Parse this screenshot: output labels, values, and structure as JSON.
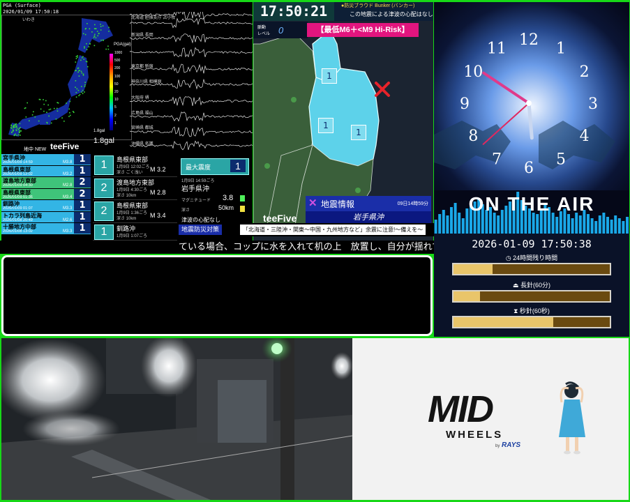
{
  "seismic": {
    "pga_title": "PGA (Surface)",
    "timestamp": "2026/01/09 17:50:18",
    "colorbar_title": "PGA(gal)",
    "colorbar_ticks": [
      "1000",
      "500",
      "200",
      "100",
      "50",
      "20",
      "10",
      "5",
      "2",
      "1"
    ],
    "max_gal_small": "1.8gal",
    "max_gal": "1.8gal",
    "status": "地中 NEW",
    "brand": "teeFive",
    "station_labels": [
      "いわき",
      "北海道 胆振支庁 苫小牧",
      "新潟県 長岡",
      "東京都 新宿",
      "神奈川県 相模原",
      "大阪府 堺",
      "広島県 福山",
      "宮崎県 都城",
      "沖縄県 名護"
    ],
    "recent_quakes": [
      {
        "loc": "宮手県沖",
        "dt": "2026/01/09 14:59",
        "mag": "M3.8",
        "int": "1",
        "color": "#33b5e5"
      },
      {
        "loc": "島根県東部",
        "dt": "2026/01/09 12:02",
        "mag": "M3.2",
        "int": "1",
        "color": "#33b5e5"
      },
      {
        "loc": "渡島地方東部",
        "dt": "2026/01/09 04:30",
        "mag": "M2.8",
        "int": "2",
        "color": "#3fc47a"
      },
      {
        "loc": "島根県東部",
        "dt": "2026/01/09 01:36",
        "mag": "M3.4",
        "int": "2",
        "color": "#3fc47a"
      },
      {
        "loc": "釧路沖",
        "dt": "2026/01/09 01:07",
        "mag": "M3.3",
        "int": "1",
        "color": "#33b5e5"
      },
      {
        "loc": "トカラ列島近海",
        "dt": "2026/01/08 20:49",
        "mag": "M2.6",
        "int": "1",
        "color": "#33b5e5"
      },
      {
        "loc": "十勝地方中部",
        "dt": "2026/01/08 13:02",
        "mag": "M3.3",
        "int": "1",
        "color": "#33b5e5"
      }
    ],
    "detail_cards": [
      {
        "int": "1",
        "loc": "島根県東部",
        "dt": "1月9日 12:02ごろ",
        "depth": "深さ ごく浅い",
        "mag": "M 3.2"
      },
      {
        "int": "2",
        "loc": "渡島地方東部",
        "dt": "1月9日 4:30ごろ",
        "depth": "深さ 10km",
        "mag": "M 2.8"
      },
      {
        "int": "2",
        "loc": "島根県東部",
        "dt": "1月9日 1:36ごろ",
        "depth": "深さ 10km",
        "mag": "M 3.4"
      },
      {
        "int": "1",
        "loc": "釧路沖",
        "dt": "1月9日 1:07ごろ",
        "depth": "",
        "mag": ""
      }
    ],
    "max_intensity_label": "最大震度",
    "max_intensity": "1",
    "latest_dt": "1月9日 14:59ごろ",
    "latest_loc": "岩手県沖",
    "magnitude_label": "マグニチュード",
    "magnitude": "3.8",
    "depth_label": "深さ",
    "depth": "50km",
    "tsunami_note": "津波の心配なし"
  },
  "tsunami": {
    "clock": "17:50:21",
    "channel": "●防災ブラウド Bunker (バンカー)",
    "tsunami_msg": "この地震による津波の心配はなし",
    "level_label": "脈動",
    "level_label2": "レベル",
    "level": "0",
    "risk_label": "【最低M6＋<M9 Hi-Risk】",
    "region_marks": [
      "1",
      "1",
      "1"
    ],
    "brand": "teeFive",
    "info_title": "地震情報",
    "info_time": "09日14時59分",
    "info_loc": "岩手県沖"
  },
  "ticker": {
    "badge": "地震防災対策",
    "warning": "「北海道・三陸沖・関東〜中国・九州地方など」余震に注意!〜備えを〜",
    "scroll": "ている場合、コップに水を入れて机の上　放置し、自分が揺れているの"
  },
  "clock": {
    "numbers": [
      "12",
      "1",
      "2",
      "3",
      "4",
      "5",
      "6",
      "7",
      "8",
      "9",
      "10",
      "11"
    ],
    "hour": 17,
    "minute": 50,
    "second": 38,
    "on_air": "ON THE AIR",
    "datetime": "2026-01-09 17:50:38",
    "remain_24h_label": "24時間残り時間",
    "remain_24h": 0.25,
    "minute_label": "長針(60分)",
    "minute_fill": 0.17,
    "second_label": "秒針(60秒)",
    "second_fill": 0.64
  },
  "ad": {
    "brand": "MID",
    "sub": "WHEELS",
    "by": "by",
    "maker": "RAYS"
  },
  "colors": {
    "background": "#17d817",
    "risk_magenta": "#e2157e",
    "cyan_alert": "#5dd2ea",
    "bar_fill": "#e9c56a",
    "onair_bars": "#1aa8e8"
  }
}
